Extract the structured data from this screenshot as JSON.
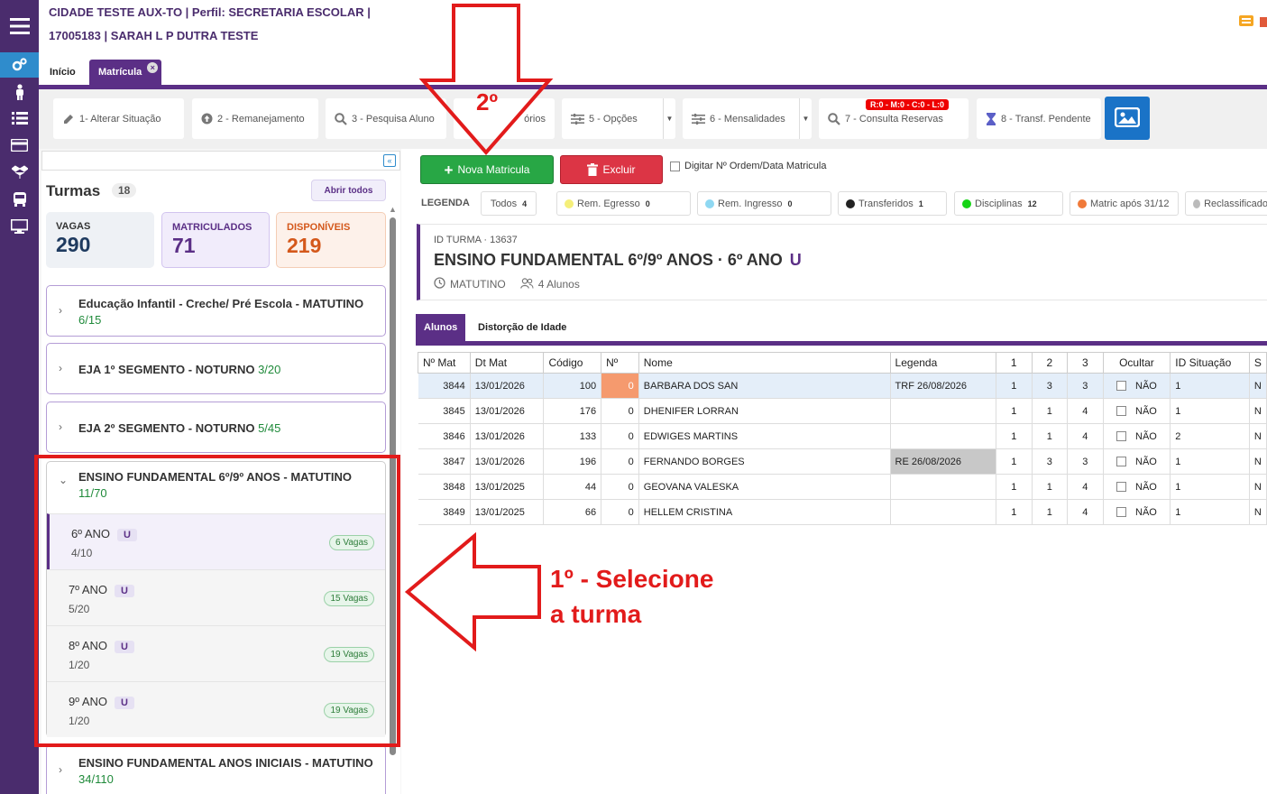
{
  "header": {
    "line1": "CIDADE TESTE AUX-TO | Perfil: SECRETARIA ESCOLAR |",
    "line2": "17005183 | SARAH L P DUTRA TESTE"
  },
  "tabs": [
    {
      "label": "Início"
    },
    {
      "label": "Matrícula"
    }
  ],
  "toolbar": {
    "items": [
      {
        "label": "1- Alterar Situação"
      },
      {
        "label": "2 - Remanejamento"
      },
      {
        "label": "3 - Pesquisa Aluno"
      },
      {
        "label": "órios"
      },
      {
        "label": "5 - Opções"
      },
      {
        "label": "6 - Mensalidades"
      },
      {
        "label": "7 - Consulta Reservas",
        "badge": "R:0 - M:0 - C:0 - L:0"
      },
      {
        "label": "8 - Transf. Pendente"
      }
    ]
  },
  "left": {
    "title": "Turmas",
    "count": "18",
    "open_all": "Abrir todos",
    "stats": {
      "vagas_label": "VAGAS",
      "vagas": "290",
      "matriculados_label": "MATRICULADOS",
      "matriculados": "71",
      "disponiveis_label": "DISPONÍVEIS",
      "disponiveis": "219"
    },
    "groups": [
      {
        "name": "Educação Infantil - Creche/ Pré Escola - MATUTINO",
        "count": "6/15"
      },
      {
        "name": "EJA 1º SEGMENTO - NOTURNO",
        "count": "3/20"
      },
      {
        "name": "EJA 2º SEGMENTO - NOTURNO",
        "count": "5/45"
      },
      {
        "name": "ENSINO FUNDAMENTAL 6º/9º ANOS - MATUTINO",
        "count": "11/70",
        "subs": [
          {
            "name": "6º ANO",
            "tag": "U",
            "occ": "4/10",
            "vagas": "6 Vagas"
          },
          {
            "name": "7º ANO",
            "tag": "U",
            "occ": "5/20",
            "vagas": "15 Vagas"
          },
          {
            "name": "8º ANO",
            "tag": "U",
            "occ": "1/20",
            "vagas": "19 Vagas"
          },
          {
            "name": "9º ANO",
            "tag": "U",
            "occ": "1/20",
            "vagas": "19 Vagas"
          }
        ]
      },
      {
        "name": "ENSINO FUNDAMENTAL ANOS INICIAIS - MATUTINO",
        "count": "34/110"
      }
    ]
  },
  "annotations": {
    "step1": "1º - Selecione",
    "step1b": "a turma",
    "step2": "2º"
  },
  "actions": {
    "nova": "Nova Matricula",
    "excluir": "Excluir",
    "digitar": "Digitar Nº Ordem/Data Matricula"
  },
  "legend": {
    "label": "LEGENDA",
    "items": [
      {
        "label": "Todos",
        "count": "4",
        "color": ""
      },
      {
        "label": "Rem. Egresso",
        "count": "0",
        "color": "#f5ef7a"
      },
      {
        "label": "Rem. Ingresso",
        "count": "0",
        "color": "#8fd8f2"
      },
      {
        "label": "Transferidos",
        "count": "1",
        "color": "#222222"
      },
      {
        "label": "Disciplinas",
        "count": "12",
        "color": "#16d416"
      },
      {
        "label": "Matric após 31/12",
        "count": "",
        "color": "#f07a3a"
      },
      {
        "label": "Reclassificado",
        "count": "",
        "color": "#bbbbbb"
      }
    ]
  },
  "turma": {
    "id": "ID TURMA · 13637",
    "title": "ENSINO FUNDAMENTAL 6º/9º ANOS · 6º ANO",
    "tag": "U",
    "turno": "MATUTINO",
    "alunos": "4 Alunos"
  },
  "subtabs": [
    {
      "label": "Alunos"
    },
    {
      "label": "Distorção de Idade"
    }
  ],
  "table": {
    "headers": [
      "Nº Mat",
      "Dt Mat",
      "Código",
      "Nº",
      "Nome",
      "Legenda",
      "1",
      "2",
      "3",
      "Ocultar",
      "ID Situação",
      "S"
    ],
    "rows": [
      {
        "mat": "3844",
        "dt": "13/01/2026",
        "cod": "100",
        "n": "0",
        "nome": "BARBARA DOS SAN",
        "leg": "TRF 26/08/2026",
        "c1": "1",
        "c2": "3",
        "c3": "3",
        "oc": "NÃO",
        "sit": "1",
        "s": "N"
      },
      {
        "mat": "3845",
        "dt": "13/01/2026",
        "cod": "176",
        "n": "0",
        "nome": "DHENIFER LORRAN",
        "leg": "",
        "c1": "1",
        "c2": "1",
        "c3": "4",
        "oc": "NÃO",
        "sit": "1",
        "s": "N"
      },
      {
        "mat": "3846",
        "dt": "13/01/2026",
        "cod": "133",
        "n": "0",
        "nome": "EDWIGES MARTINS",
        "leg": "",
        "c1": "1",
        "c2": "1",
        "c3": "4",
        "oc": "NÃO",
        "sit": "2",
        "s": "N"
      },
      {
        "mat": "3847",
        "dt": "13/01/2026",
        "cod": "196",
        "n": "0",
        "nome": "FERNANDO BORGES",
        "leg": "RE 26/08/2026",
        "c1": "1",
        "c2": "3",
        "c3": "3",
        "oc": "NÃO",
        "sit": "1",
        "s": "N"
      },
      {
        "mat": "3848",
        "dt": "13/01/2025",
        "cod": "44",
        "n": "0",
        "nome": "GEOVANA VALESKA",
        "leg": "",
        "c1": "1",
        "c2": "1",
        "c3": "4",
        "oc": "NÃO",
        "sit": "1",
        "s": "N"
      },
      {
        "mat": "3849",
        "dt": "13/01/2025",
        "cod": "66",
        "n": "0",
        "nome": "HELLEM CRISTINA",
        "leg": "",
        "c1": "1",
        "c2": "1",
        "c3": "4",
        "oc": "NÃO",
        "sit": "1",
        "s": "N"
      }
    ]
  }
}
